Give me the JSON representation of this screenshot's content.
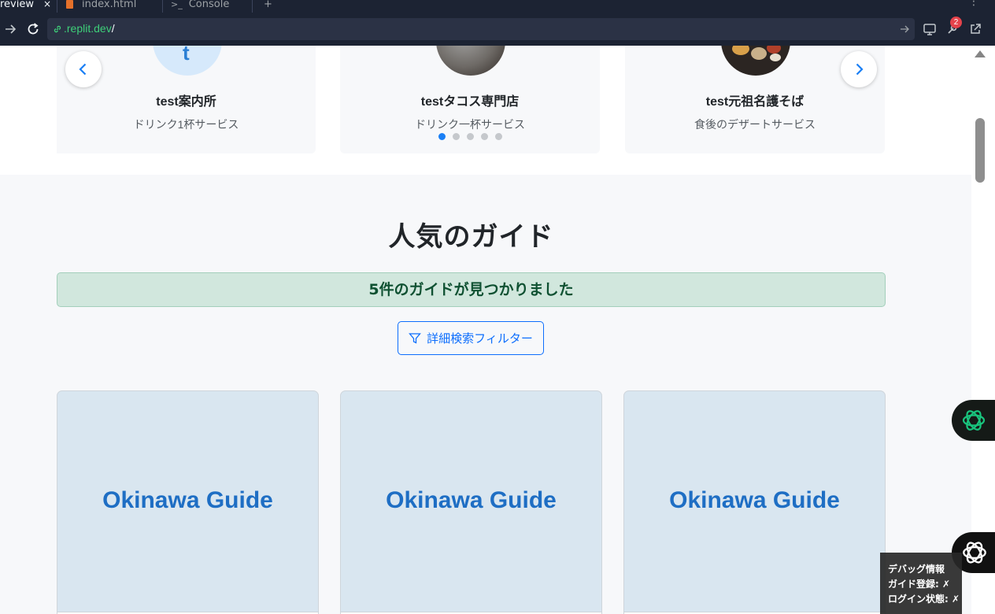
{
  "browser": {
    "tabs": [
      {
        "label": "review",
        "active": true,
        "close": "×"
      },
      {
        "label": "index.html",
        "active": false,
        "icon": "html-file-icon"
      },
      {
        "label": "Console",
        "active": false,
        "icon": "terminal-icon"
      }
    ],
    "new_tab": "+",
    "url_domain": ".replit.dev",
    "url_path": "/",
    "notification_count": "2",
    "colors": {
      "chrome": "#1c2333",
      "url_field": "#2b3245",
      "url_text": "#3ecf79"
    }
  },
  "stores": {
    "items": [
      {
        "name": "test案内所",
        "service": "ドリンク1杯サービス",
        "avatar_text": "t"
      },
      {
        "name": "testタコス専門店",
        "service": "ドリンク一杯サービス"
      },
      {
        "name": "test元祖名護そば",
        "service": "食後のデザートサービス"
      }
    ],
    "dots_total": 5,
    "dots_active": 0,
    "prev_icon": "chevron-left-icon",
    "next_icon": "chevron-right-icon"
  },
  "guides": {
    "title": "人気のガイド",
    "result_message": "5件のガイドが見つかりました",
    "filter_button_label": "詳細検索フィルター",
    "filter_icon": "filter-funnel-icon",
    "cards": [
      {
        "image_text": "Okinawa Guide"
      },
      {
        "image_text": "Okinawa Guide"
      },
      {
        "image_text": "Okinawa Guide"
      }
    ],
    "colors": {
      "banner_bg": "#d1e7dd",
      "banner_text": "#0f5132",
      "primary": "#0d6efd",
      "card_image_bg": "#d9e6f0"
    }
  },
  "debug": {
    "title": "デバッグ情報",
    "guide_registered": "ガイド登録: ✗",
    "login_status": "ログイン状態: ✗"
  }
}
